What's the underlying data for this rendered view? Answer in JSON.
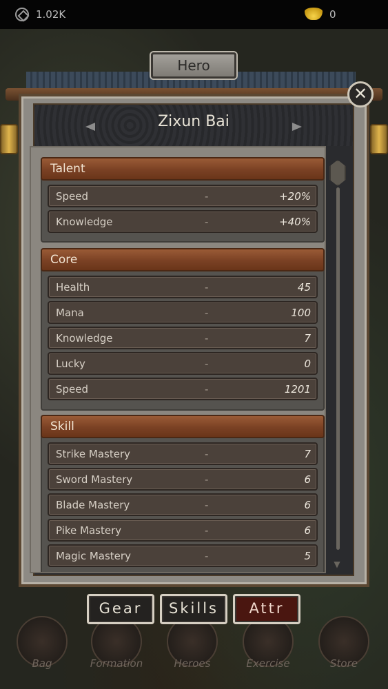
{
  "status": {
    "coins": "1.02K",
    "ingots": "0"
  },
  "panel": {
    "tab_title": "Hero",
    "hero_name": "Zixun Bai",
    "close": "✕"
  },
  "sections": [
    {
      "title": "Talent",
      "rows": [
        {
          "label": "Speed",
          "dash": "-",
          "value": "+20%"
        },
        {
          "label": "Knowledge",
          "dash": "-",
          "value": "+40%"
        }
      ]
    },
    {
      "title": "Core",
      "rows": [
        {
          "label": "Health",
          "dash": "-",
          "value": "45"
        },
        {
          "label": "Mana",
          "dash": "-",
          "value": "100"
        },
        {
          "label": "Knowledge",
          "dash": "-",
          "value": "7"
        },
        {
          "label": "Lucky",
          "dash": "-",
          "value": "0"
        },
        {
          "label": "Speed",
          "dash": "-",
          "value": "1201"
        }
      ]
    },
    {
      "title": "Skill",
      "rows": [
        {
          "label": "Strike Mastery",
          "dash": "-",
          "value": "7"
        },
        {
          "label": "Sword Mastery",
          "dash": "-",
          "value": "6"
        },
        {
          "label": "Blade Mastery",
          "dash": "-",
          "value": "6"
        },
        {
          "label": "Pike Mastery",
          "dash": "-",
          "value": "6"
        },
        {
          "label": "Magic Mastery",
          "dash": "-",
          "value": "5"
        }
      ]
    }
  ],
  "tabs": {
    "gear": "Gear",
    "skills": "Skills",
    "attr": "Attr"
  },
  "nav": {
    "bag": "Bag",
    "formation": "Formation",
    "heroes": "Heroes",
    "exercise": "Exercise",
    "store": "Store"
  },
  "icons": [
    "coin-icon",
    "ingot-icon",
    "close-icon",
    "arrow-left-icon",
    "arrow-right-icon"
  ]
}
